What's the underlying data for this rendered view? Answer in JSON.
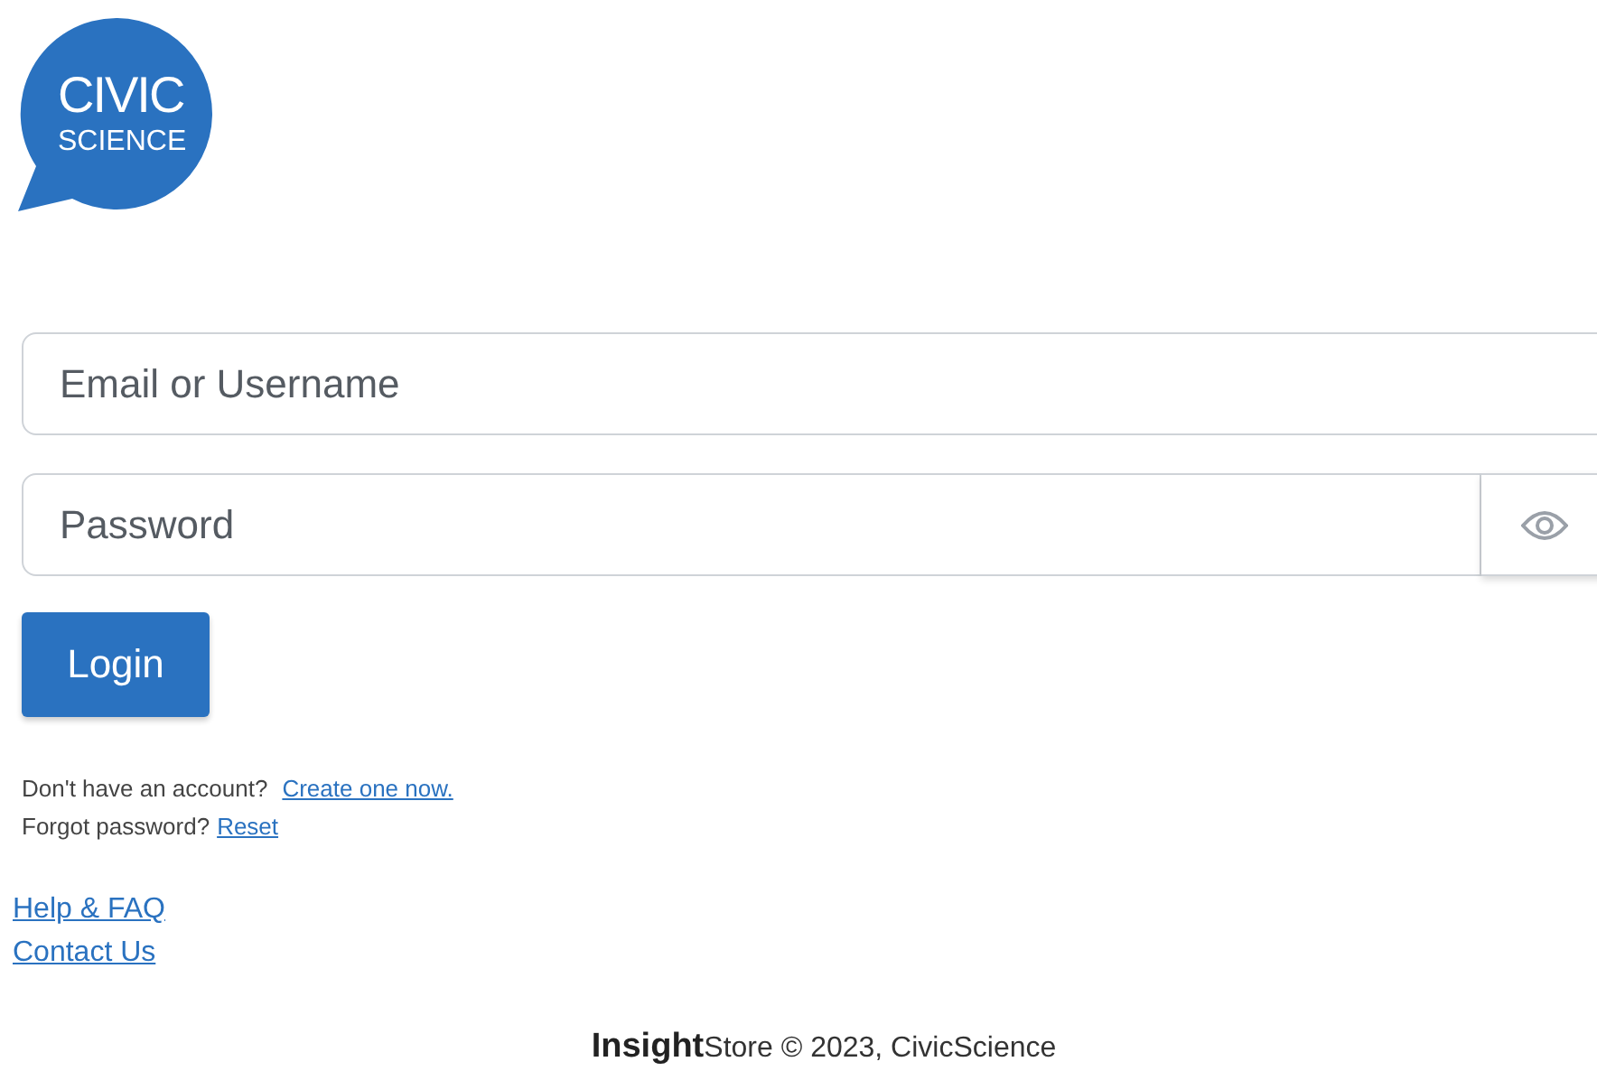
{
  "logo": {
    "line_1": "CIVIC",
    "line_2": "SCIENCE"
  },
  "form": {
    "email": {
      "placeholder": "Email or Username"
    },
    "password": {
      "placeholder": "Password"
    },
    "login_button": "Login"
  },
  "account_links": [
    {
      "prompt": "Don't have an account?",
      "link": "Create one now."
    },
    {
      "prompt": "Forgot password?",
      "link": "Reset"
    }
  ],
  "help_links": [
    "Help & FAQ",
    "Contact Us"
  ],
  "footer": "**Insight**Store © 2023, CivicScience"
}
